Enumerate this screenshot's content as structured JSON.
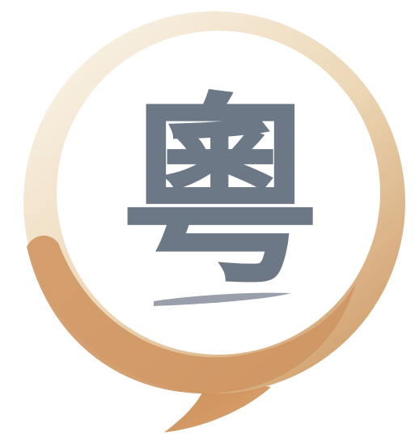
{
  "logo": {
    "glyph": "粵",
    "colors": {
      "ring_light": "#f8f0e2",
      "ring_mid": "#ecd6b4",
      "ring_dark": "#cf9c69",
      "tail": "#c98b54",
      "inner": "#ffffff",
      "glyph": "#6d7887"
    }
  }
}
